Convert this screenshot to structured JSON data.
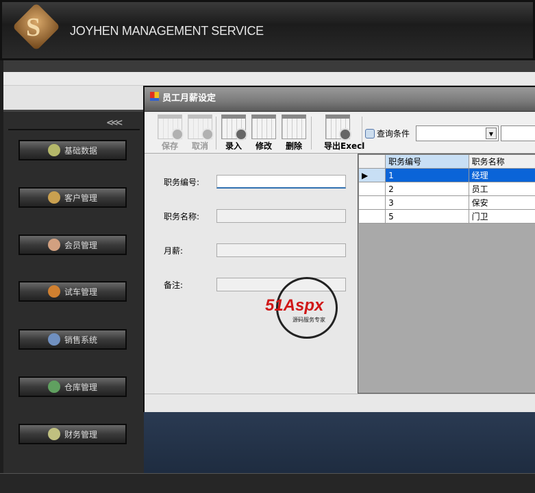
{
  "header": {
    "brand": "JOYHEN  MANAGEMENT SERVICE",
    "logo_letter": "S"
  },
  "sidebar": {
    "collapse": "<<<",
    "items": [
      {
        "label": "基础数据",
        "icon": "gear-icon",
        "color": "#b5b86a"
      },
      {
        "label": "客户管理",
        "icon": "users-icon",
        "color": "#c9a050"
      },
      {
        "label": "会员管理",
        "icon": "member-icon",
        "color": "#d2a080"
      },
      {
        "label": "试车管理",
        "icon": "signpost-icon",
        "color": "#d08030"
      },
      {
        "label": "销售系统",
        "icon": "monitor-icon",
        "color": "#7090c0"
      },
      {
        "label": "仓库管理",
        "icon": "warehouse-icon",
        "color": "#60a060"
      },
      {
        "label": "财务管理",
        "icon": "finance-icon",
        "color": "#c0c080"
      }
    ]
  },
  "dialog": {
    "title": "员工月薪设定",
    "toolbar": {
      "save": "保存",
      "cancel": "取消",
      "add": "录入",
      "edit": "修改",
      "delete": "删除",
      "export": "导出Execl",
      "query_label": "查询条件",
      "query_value": "",
      "query_text": ""
    },
    "form": {
      "id_label": "职务编号:",
      "name_label": "职务名称:",
      "salary_label": "月薪:",
      "note_label": "备注:",
      "id_value": "",
      "name_value": "",
      "salary_value": "",
      "note_value": ""
    },
    "grid": {
      "columns": [
        "职务编号",
        "职务名称"
      ],
      "rows": [
        [
          "1",
          "经理"
        ],
        [
          "2",
          "员工"
        ],
        [
          "3",
          "保安"
        ],
        [
          "5",
          "门卫"
        ]
      ]
    }
  },
  "watermark": {
    "text": "51Aspx",
    "sub": "源码服务专家"
  }
}
